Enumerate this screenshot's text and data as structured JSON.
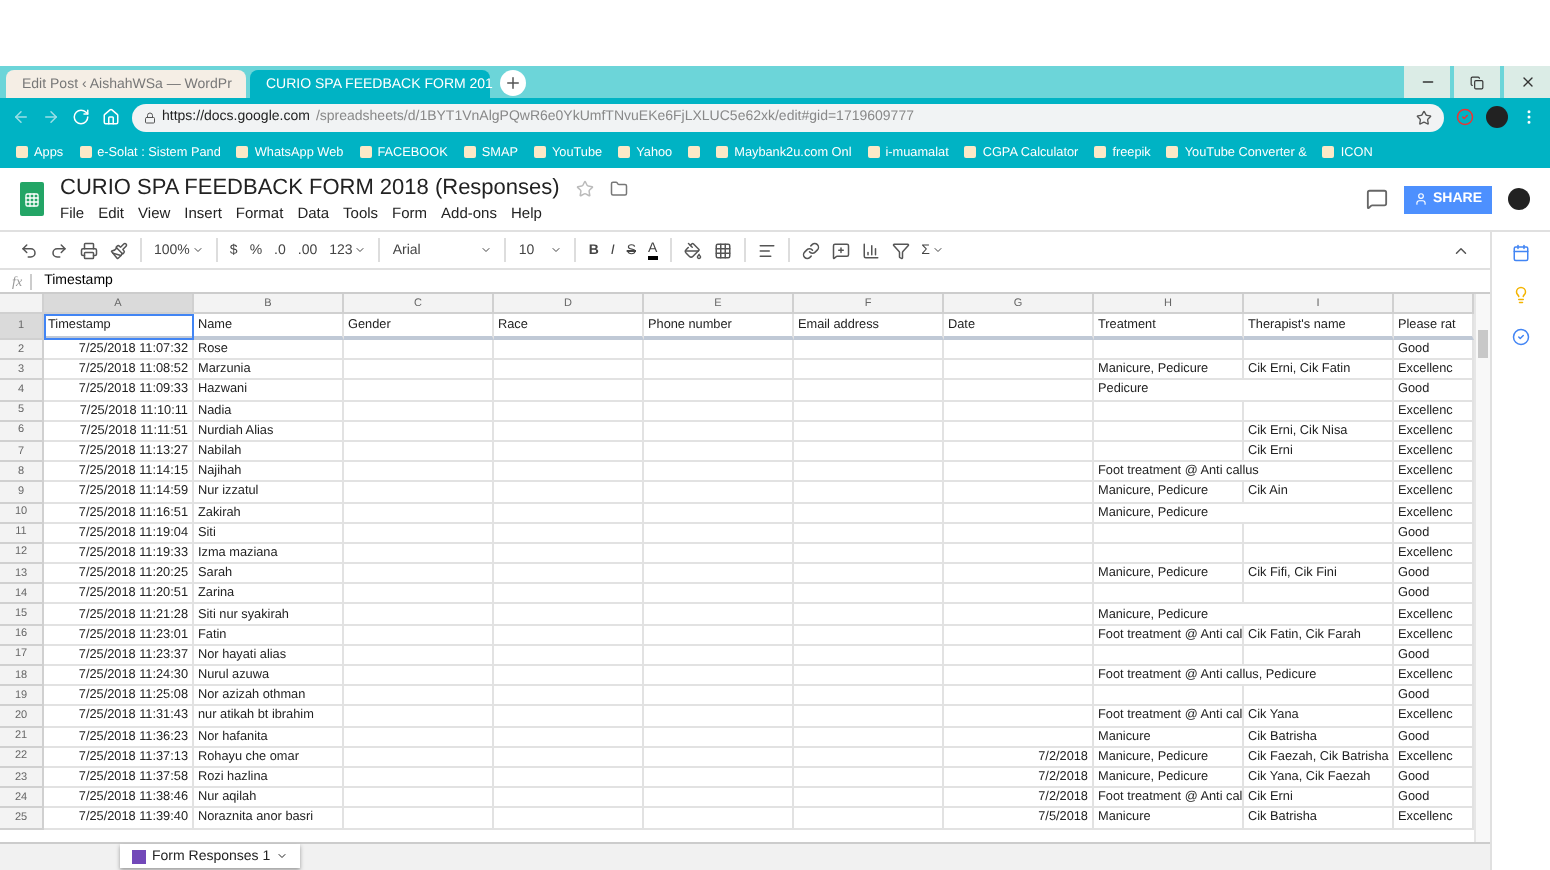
{
  "browser": {
    "tabs": [
      {
        "title": "Edit Post ‹ AishahWSa — WordPr",
        "selected": false
      },
      {
        "title": "CURIO SPA FEEDBACK FORM 201",
        "selected": true
      }
    ],
    "url_host": "https://docs.google.com",
    "url_path": "/spreadsheets/d/1BYT1VnAlgPQwR6e0YkUmfTNvuEKe6FjLXLUC5e62xk/edit#gid=1719609777",
    "bookmarks": [
      {
        "kind": "link",
        "label": "Apps"
      },
      {
        "kind": "link",
        "label": "e-Solat : Sistem Pand"
      },
      {
        "kind": "link",
        "label": "WhatsApp Web"
      },
      {
        "kind": "link",
        "label": "FACEBOOK"
      },
      {
        "kind": "link",
        "label": "SMAP"
      },
      {
        "kind": "link",
        "label": "YouTube"
      },
      {
        "kind": "link",
        "label": "Yahoo"
      },
      {
        "kind": "icon"
      },
      {
        "kind": "link",
        "label": "Maybank2u.com Onl"
      },
      {
        "kind": "link",
        "label": "i-muamalat"
      },
      {
        "kind": "link",
        "label": "CGPA Calculator"
      },
      {
        "kind": "link",
        "label": "freepik"
      },
      {
        "kind": "link",
        "label": "YouTube Converter &"
      },
      {
        "kind": "link",
        "label": "ICON"
      }
    ]
  },
  "document": {
    "title": "CURIO SPA FEEDBACK FORM 2018 (Responses)",
    "menu": [
      "File",
      "Edit",
      "View",
      "Insert",
      "Format",
      "Data",
      "Tools",
      "Form",
      "Add-ons",
      "Help"
    ],
    "share": "SHARE"
  },
  "toolbar": {
    "zoom": "100%",
    "currency": "$",
    "percent": "%",
    "decimal_less": ".0",
    "decimal_more": ".00",
    "number_format": "123",
    "font": "Arial",
    "font_size": "10",
    "bold": "B",
    "italic": "I",
    "strikethrough": "S",
    "text_color": "A",
    "functions": "Σ"
  },
  "formula_bar": {
    "label": "fx",
    "value": "Timestamp"
  },
  "columns": [
    {
      "letter": "A",
      "heading": "Timestamp",
      "selected": true
    },
    {
      "letter": "B",
      "heading": "Name",
      "selected": false
    },
    {
      "letter": "C",
      "heading": "Gender",
      "selected": false
    },
    {
      "letter": "D",
      "heading": "Race",
      "selected": false
    },
    {
      "letter": "E",
      "heading": "Phone number",
      "selected": false
    },
    {
      "letter": "F",
      "heading": "Email address",
      "selected": false
    },
    {
      "letter": "G",
      "heading": "Date",
      "selected": false
    },
    {
      "letter": "H",
      "heading": "Treatment",
      "selected": false
    },
    {
      "letter": "I",
      "heading": "Therapist's name",
      "selected": false
    },
    {
      "heading": "Please rat",
      "selected": false
    }
  ],
  "rows": [
    {
      "number": "2",
      "timestamp": "7/25/2018 11:07:32",
      "name": "Rose",
      "rating": "Good"
    },
    {
      "number": "3",
      "timestamp": "7/25/2018 11:08:52",
      "name": "Marzunia",
      "treatment": "Manicure, Pedicure",
      "therapist": "Cik Erni, Cik Fatin",
      "rating": "Excellenc"
    },
    {
      "number": "4",
      "timestamp": "7/25/2018 11:09:33",
      "name": "Hazwani",
      "treatment": "Pedicure",
      "rating": "Good"
    },
    {
      "number": "5",
      "timestamp": "7/25/2018 11:10:11",
      "name": "Nadia",
      "rating": "Excellenc"
    },
    {
      "number": "6",
      "timestamp": "7/25/2018 11:11:51",
      "name": "Nurdiah Alias",
      "therapist": "Cik Erni, Cik Nisa",
      "rating": "Excellenc"
    },
    {
      "number": "7",
      "timestamp": "7/25/2018 11:13:27",
      "name": "Nabilah",
      "therapist": "Cik Erni",
      "rating": "Excellenc"
    },
    {
      "number": "8",
      "timestamp": "7/25/2018 11:14:15",
      "name": "Najihah",
      "treatment": "Foot treatment @ Anti callus",
      "rating": "Excellenc"
    },
    {
      "number": "9",
      "timestamp": "7/25/2018 11:14:59",
      "name": "Nur izzatul",
      "treatment": "Manicure, Pedicure",
      "therapist": "Cik Ain",
      "rating": "Excellenc"
    },
    {
      "number": "10",
      "timestamp": "7/25/2018 11:16:51",
      "name": "Zakirah",
      "treatment": "Manicure, Pedicure",
      "rating": "Excellenc"
    },
    {
      "number": "11",
      "timestamp": "7/25/2018 11:19:04",
      "name": "Siti",
      "rating": "Good"
    },
    {
      "number": "12",
      "timestamp": "7/25/2018 11:19:33",
      "name": "Izma maziana",
      "rating": "Excellenc"
    },
    {
      "number": "13",
      "timestamp": "7/25/2018 11:20:25",
      "name": "Sarah",
      "treatment": "Manicure, Pedicure",
      "therapist": "Cik Fifi, Cik Fini",
      "rating": "Good"
    },
    {
      "number": "14",
      "timestamp": "7/25/2018 11:20:51",
      "name": "Zarina",
      "rating": "Good"
    },
    {
      "number": "15",
      "timestamp": "7/25/2018 11:21:28",
      "name": "Siti nur syakirah",
      "treatment": "Manicure, Pedicure",
      "rating": "Excellenc"
    },
    {
      "number": "16",
      "timestamp": "7/25/2018 11:23:01",
      "name": "Fatin",
      "treatment": "Foot treatment @ Anti cal",
      "therapist": "Cik Fatin, Cik Farah",
      "rating": "Excellenc"
    },
    {
      "number": "17",
      "timestamp": "7/25/2018 11:23:37",
      "name": "Nor hayati alias",
      "rating": "Good"
    },
    {
      "number": "18",
      "timestamp": "7/25/2018 11:24:30",
      "name": "Nurul azuwa",
      "treatment": "Foot treatment @ Anti callus, Pedicure",
      "rating": "Excellenc"
    },
    {
      "number": "19",
      "timestamp": "7/25/2018 11:25:08",
      "name": "Nor azizah othman",
      "rating": "Good"
    },
    {
      "number": "20",
      "timestamp": "7/25/2018 11:31:43",
      "name": "nur atikah bt ibrahim",
      "treatment": "Foot treatment @ Anti cal",
      "therapist": "Cik Yana",
      "rating": "Excellenc"
    },
    {
      "number": "21",
      "timestamp": "7/25/2018 11:36:23",
      "name": "Nor hafanita",
      "treatment": "Manicure",
      "therapist": "Cik Batrisha",
      "rating": "Good"
    },
    {
      "number": "22",
      "timestamp": "7/25/2018 11:37:13",
      "name": "Rohayu che omar",
      "date": "7/2/2018",
      "treatment": "Manicure, Pedicure",
      "therapist": "Cik Faezah, Cik Batrisha",
      "rating": "Excellenc"
    },
    {
      "number": "23",
      "timestamp": "7/25/2018 11:37:58",
      "name": "Rozi hazlina",
      "date": "7/2/2018",
      "treatment": "Manicure, Pedicure",
      "therapist": "Cik Yana, Cik Faezah",
      "rating": "Good"
    },
    {
      "number": "24",
      "timestamp": "7/25/2018 11:38:46",
      "name": "Nur aqilah",
      "date": "7/2/2018",
      "treatment": "Foot treatment @ Anti cal",
      "therapist": "Cik Erni",
      "rating": "Good"
    },
    {
      "number": "25",
      "timestamp": "7/25/2018 11:39:40",
      "name": "Noraznita anor basri",
      "date": "7/5/2018",
      "treatment": "Manicure",
      "therapist": "Cik Batrisha",
      "rating": "Excellenc"
    }
  ],
  "header_row_number": "1",
  "sheet_tabs": [
    {
      "label": "Form Responses 1",
      "selected": true
    }
  ]
}
